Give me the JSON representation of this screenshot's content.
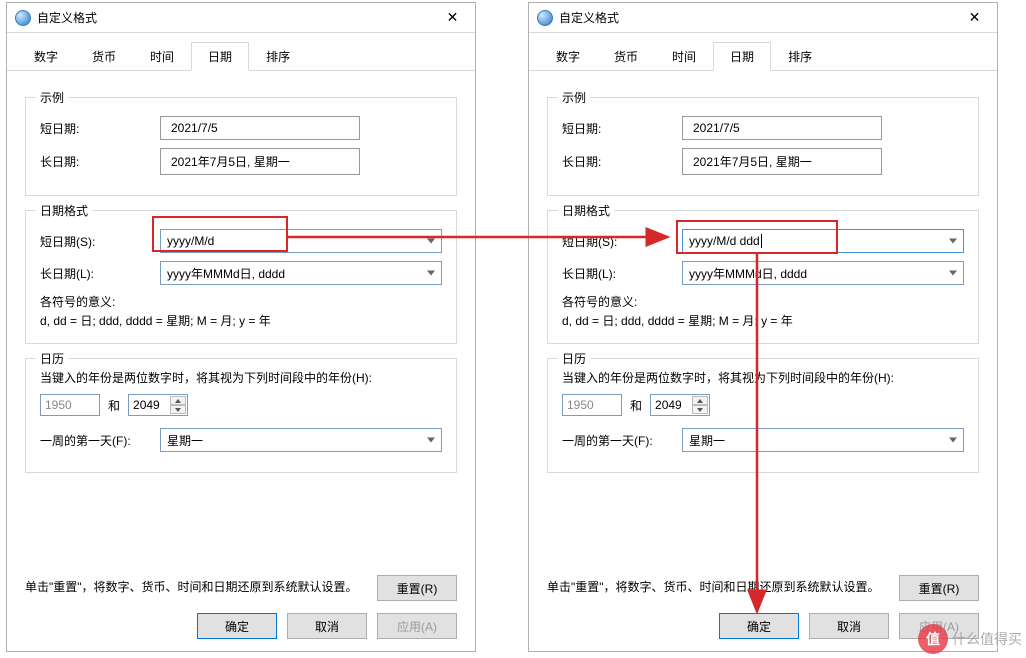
{
  "title": "自定义格式",
  "tabs": {
    "number": "数字",
    "currency": "货币",
    "time": "时间",
    "date": "日期",
    "sort": "排序"
  },
  "groups": {
    "example": "示例",
    "date_format": "日期格式",
    "calendar": "日历"
  },
  "labels": {
    "short_date": "短日期:",
    "long_date": "长日期:",
    "short_date_s": "短日期(S):",
    "long_date_l": "长日期(L):",
    "symbol_header": "各符号的意义:",
    "symbol_body": "d, dd = 日;  ddd, dddd = 星期;  M = 月;  y = 年",
    "cal_line": "当键入的年份是两位数字时，将其视为下列时间段中的年份(H):",
    "and": "和",
    "first_day": "一周的第一天(F):",
    "reset_text": "单击\"重置\"，将数字、货币、时间和日期还原到系统默认设置。"
  },
  "examples": {
    "short": "2021/7/5",
    "long": "2021年7月5日, 星期一"
  },
  "formats_left": {
    "short": "yyyy/M/d",
    "long": "yyyy年MMMd日, dddd"
  },
  "formats_right": {
    "short": "yyyy/M/d ddd",
    "long": "yyyy年MMMd日, dddd"
  },
  "calendar": {
    "year_from": "1950",
    "year_to": "2049",
    "first_day_value": "星期一"
  },
  "buttons": {
    "reset": "重置(R)",
    "ok": "确定",
    "cancel": "取消",
    "apply": "应用(A)"
  },
  "watermark": {
    "logo": "值",
    "text": "什么值得买"
  },
  "colors": {
    "highlight": "#d62828"
  }
}
